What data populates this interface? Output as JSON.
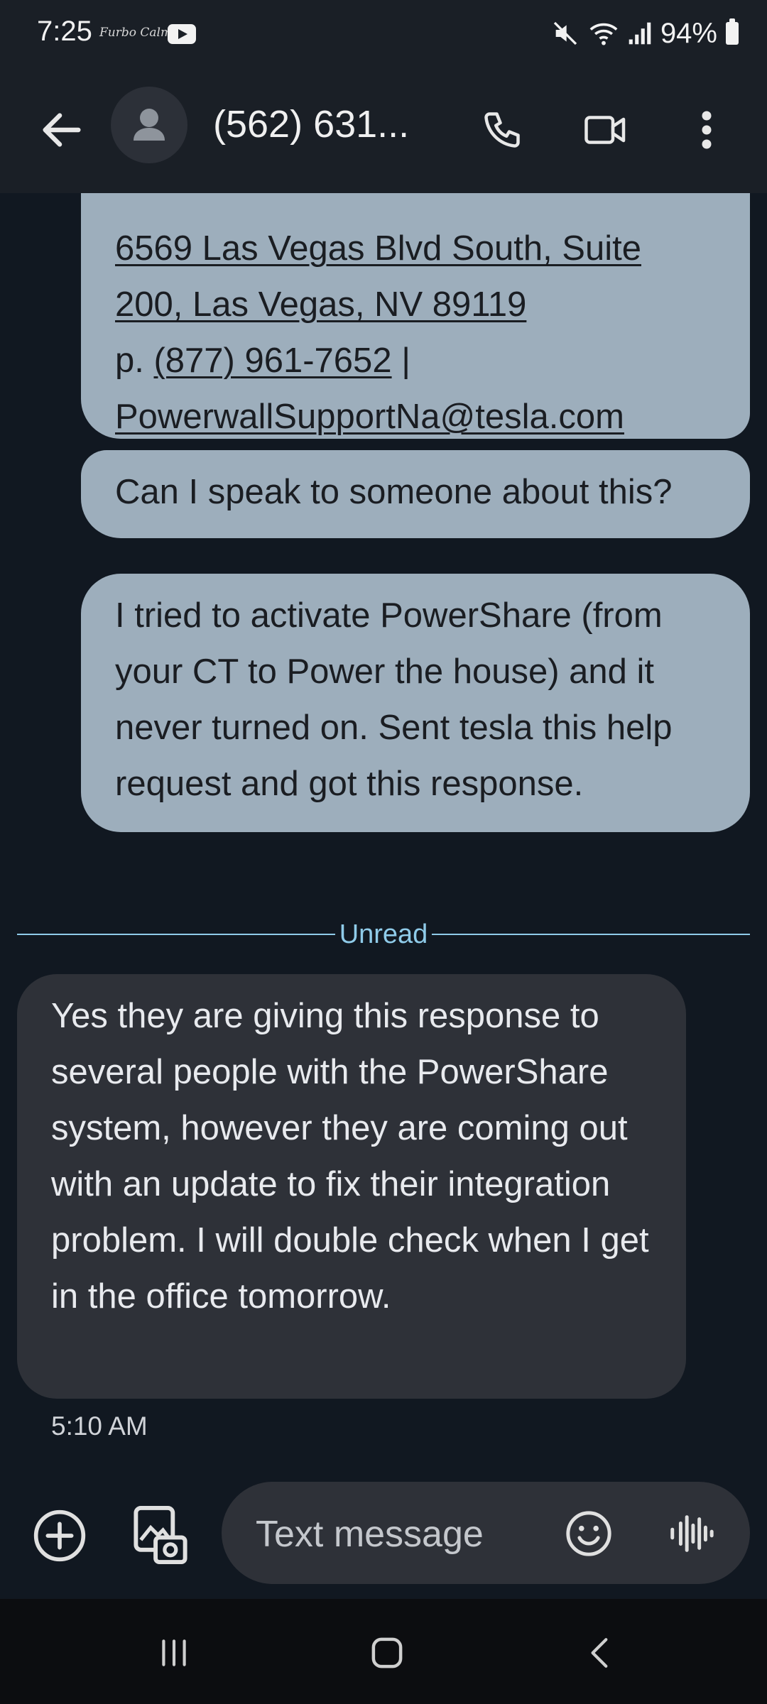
{
  "status_bar": {
    "time": "7:25",
    "notification_text": "Furbo Calm",
    "battery": "94%"
  },
  "header": {
    "contact": "(562) 631..."
  },
  "messages": {
    "outgoing_1": {
      "line_1": "6569 Las Vegas Blvd South, Suite",
      "line_2": "200, Las Vegas, NV 89119",
      "line_3_prefix": "p. ",
      "phone": "(877) 961-7652",
      "line_3_suffix": " |",
      "email": "PowerwallSupportNa@tesla.com"
    },
    "outgoing_2": "Can I speak to someone about this?",
    "outgoing_3": "I tried to activate PowerShare (from your CT to Power the house) and it never turned on.  Sent tesla this help request and got this response.",
    "unread_label": "Unread",
    "incoming_1": "Yes they are giving this response to several people with the PowerShare system, however they are coming out with an update to fix their integration problem. I will double check when I get in the office tomorrow.",
    "incoming_1_time": "5:10 AM"
  },
  "composer": {
    "placeholder": "Text message"
  },
  "colors": {
    "background": "#111821",
    "outgoing_bubble": "#9daebc",
    "incoming_bubble": "#2e3138",
    "unread_accent": "#8fcbe9"
  }
}
